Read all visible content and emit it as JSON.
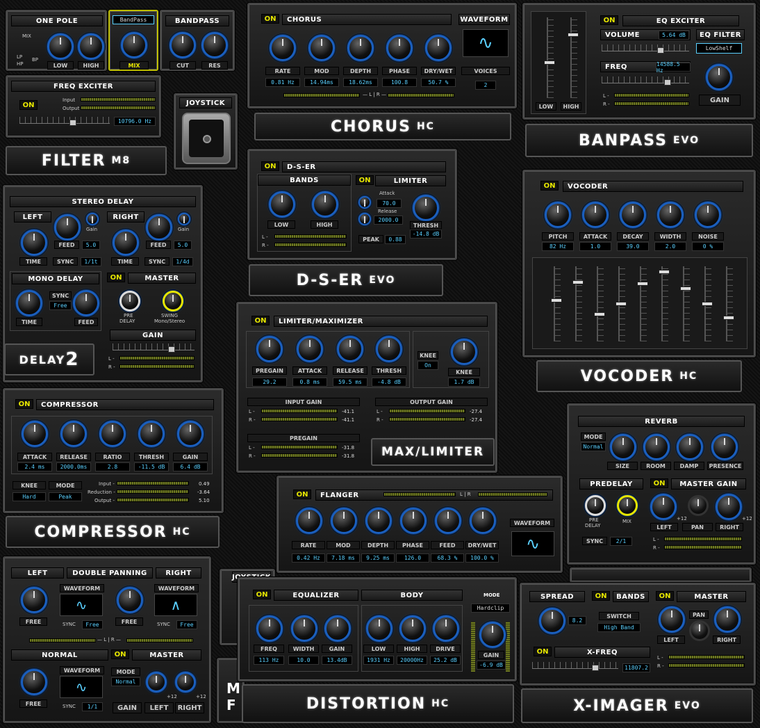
{
  "one_pole": {
    "title": "ONE POLE",
    "mix": "MIX",
    "lp": "LP",
    "hp": "HP",
    "bp": "BP",
    "low": "LOW",
    "high": "HIGH"
  },
  "mode_box": {
    "value": "BandPass",
    "mix": "MIX"
  },
  "bandpass": {
    "title": "BANDPASS",
    "cut": "CUT",
    "res": "RES"
  },
  "freq_exciter": {
    "title": "FREQ EXCITER",
    "on": "ON",
    "input": "Input",
    "output": "Output",
    "value": "10796.0 Hz"
  },
  "joystick": {
    "title": "JOYSTICK",
    "title2": "JOYSTICK"
  },
  "filter_logo": {
    "name": "FILTER",
    "suffix": "M8"
  },
  "chorus": {
    "on": "ON",
    "title": "CHORUS",
    "waveform": "WAVEFORM",
    "voices": "VOICES",
    "voices_value": "2",
    "knobs": [
      {
        "label": "RATE",
        "value": "0.81 Hz"
      },
      {
        "label": "MOD",
        "value": "14.94ms"
      },
      {
        "label": "DEPTH",
        "value": "18.62ms"
      },
      {
        "label": "PHASE",
        "value": "100.8"
      },
      {
        "label": "DRY/WET",
        "value": "50.7 %"
      }
    ],
    "lr": "— L | R —"
  },
  "chorus_logo": {
    "name": "CHORUS",
    "suffix": "HC"
  },
  "eq_exciter": {
    "on": "ON",
    "title": "EQ EXCITER",
    "volume": "VOLUME",
    "volume_value": "5.64 dB",
    "freq": "FREQ",
    "freq_value": "14588.5 Hz",
    "eq_filter": "EQ FILTER",
    "eq_filter_value": "LowShelf",
    "gain": "GAIN",
    "low": "LOW",
    "high": "HIGH",
    "l": "L -",
    "r": "R -"
  },
  "banpass_logo": {
    "name": "BANPASS",
    "suffix": "EVO"
  },
  "dser": {
    "on": "ON",
    "title": "D-S-ER",
    "bands": "BANDS",
    "low": "LOW",
    "high": "HIGH",
    "l": "L -",
    "r": "R -"
  },
  "limiter": {
    "on": "ON",
    "title": "LIMITER",
    "attack": "Attack",
    "attack_value": "70.0",
    "release": "Release",
    "release_value": "2000.0",
    "thresh": "THRESH",
    "thresh_value": "-14.8 dB",
    "peak": "PEAK",
    "peak_value": "0.88"
  },
  "dser_logo": {
    "name": "D-S-ER",
    "suffix": "EVO"
  },
  "vocoder": {
    "on": "ON",
    "title": "VOCODER",
    "knobs": [
      {
        "label": "PITCH",
        "value": "82  Hz"
      },
      {
        "label": "ATTACK",
        "value": "1.0"
      },
      {
        "label": "DECAY",
        "value": "39.0"
      },
      {
        "label": "WIDTH",
        "value": "2.0"
      },
      {
        "label": "NOISE",
        "value": "0 %"
      }
    ],
    "slider_levels": [
      0.55,
      0.8,
      0.35,
      0.5,
      0.78,
      0.95,
      0.72,
      0.5,
      0.3
    ]
  },
  "vocoder_logo": {
    "name": "VOCODER",
    "suffix": "HC"
  },
  "stereo_delay": {
    "title": "STEREO DELAY",
    "left": "LEFT",
    "right": "RIGHT",
    "gain": "Gain",
    "feed": "FEED",
    "feed_value": "5.0",
    "time": "TIME",
    "sync": "SYNC",
    "sync_l": "1/1t",
    "sync_r": "1/4d",
    "gain_r": "Gain",
    "feed_r": "FEED",
    "feed_value_r": "5.0",
    "time_r": "TIME",
    "sync_r_label": "SYNC"
  },
  "mono_delay": {
    "title": "MONO DELAY",
    "sync": "SYNC",
    "sync_value": "Free",
    "time": "TIME",
    "feed": "FEED"
  },
  "delay_master": {
    "on": "ON",
    "title": "MASTER",
    "pre": "PRE",
    "delay": "DELAY",
    "swing": "SWING",
    "swing_mode": "Mono/Stereo",
    "gain": "GAIN",
    "l": "L -",
    "r": "R -"
  },
  "delay_logo": {
    "name": "DELAY",
    "suffix": "2"
  },
  "lim_max": {
    "on": "ON",
    "title": "LIMITER/MAXIMIZER",
    "knobs": [
      {
        "label": "PREGAIN",
        "value": "29.2"
      },
      {
        "label": "ATTACK",
        "value": "0.8  ms"
      },
      {
        "label": "RELEASE",
        "value": "59.5  ms"
      },
      {
        "label": "THRESH",
        "value": "-4.8  dB"
      }
    ],
    "knee": "KNEE",
    "knee_state": "On",
    "knee_label": "KNEE",
    "knee_value": "1.7 dB",
    "input_gain": "INPUT GAIN",
    "in_l": "-41.1",
    "in_r": "-41.1",
    "output_gain": "OUTPUT GAIN",
    "out_l": "-27.4",
    "out_r": "-27.4",
    "pregain": "PREGAIN",
    "pre_l": "-31.8",
    "pre_r": "-31.8",
    "l": "L -",
    "r": "R -"
  },
  "maxlimiter_logo": {
    "name": "MAX/LIMITER"
  },
  "compressor": {
    "on": "ON",
    "title": "COMPRESSOR",
    "knobs": [
      {
        "label": "ATTACK",
        "value": "2.4  ms"
      },
      {
        "label": "RELEASE",
        "value": "2000.0ms"
      },
      {
        "label": "RATIO",
        "value": "2.8"
      },
      {
        "label": "THRESH",
        "value": "-11.5 dB"
      },
      {
        "label": "GAIN",
        "value": "6.4 dB"
      }
    ],
    "knee": "KNEE",
    "knee_value": "Hard",
    "mode": "MODE",
    "mode_value": "Peak",
    "input": "Input -",
    "reduction": "Reduction -",
    "output": "Output -",
    "input_value": "0.49",
    "reduction_value": "-3.64",
    "output_value": "5.10"
  },
  "compressor_logo": {
    "name": "COMPRESSOR",
    "suffix": "HC"
  },
  "reverb": {
    "title": "REVERB",
    "mode": "MODE",
    "mode_value": "Normal",
    "size": "SIZE",
    "room": "ROOM",
    "damp": "DAMP",
    "presence": "PRESENCE",
    "predelay": "PREDELAY",
    "pre": "PRE",
    "delay": "DELAY",
    "mix": "MIX",
    "sync": "SYNC",
    "sync_value": "2/1",
    "on": "ON",
    "master_gain": "MASTER GAIN",
    "left": "LEFT",
    "pan": "PAN",
    "right": "RIGHT",
    "plus12": "+12",
    "plus12b": "+12",
    "l": "L -",
    "r": "R -"
  },
  "flanger": {
    "on": "ON",
    "title": "FLANGER",
    "lr": "L | R",
    "waveform": "WAVEFORM",
    "knobs": [
      {
        "label": "RATE",
        "value": "0.42 Hz"
      },
      {
        "label": "MOD",
        "value": "7.18 ms"
      },
      {
        "label": "DEPTH",
        "value": "9.25 ms"
      },
      {
        "label": "PHASE",
        "value": "126.0"
      },
      {
        "label": "FEED",
        "value": "68.3 %"
      },
      {
        "label": "DRY/WET",
        "value": "100.0 %"
      }
    ]
  },
  "double_panning": {
    "left": "LEFT",
    "title": "DOUBLE PANNING",
    "right": "RIGHT",
    "waveform": "WAVEFORM",
    "waveform2": "WAVEFORM",
    "free": "FREE",
    "free2": "FREE",
    "sync": "SYNC",
    "sync_value": "Free",
    "sync2": "SYNC",
    "sync_value2": "Free",
    "lr": "— L | R —",
    "normal": "NORMAL",
    "on": "ON",
    "master": "MASTER",
    "waveform3": "WAVEFORM",
    "free3": "FREE",
    "sync3": "SYNC",
    "sync_value3": "1/1",
    "mode": "MODE",
    "mode_value": "Normal",
    "plus12": "+12",
    "plus12b": "+12",
    "gain": "GAIN",
    "m_left": "LEFT",
    "m_right": "RIGHT"
  },
  "distortion": {
    "on": "ON",
    "equalizer": "EQUALIZER",
    "body": "BODY",
    "mode": "MODE",
    "mode_value": "Hardclip",
    "eq_knobs": [
      {
        "label": "FREQ",
        "value": "113  Hz"
      },
      {
        "label": "WIDTH",
        "value": "10.0"
      },
      {
        "label": "GAIN",
        "value": "13.4dB"
      }
    ],
    "body_knobs": [
      {
        "label": "LOW",
        "value": "1931 Hz"
      },
      {
        "label": "HIGH",
        "value": "20000Hz"
      },
      {
        "label": "DRIVE",
        "value": "25.2 dB"
      }
    ],
    "gain": "GAIN",
    "gain_value": "-6.9 dB"
  },
  "distortion_logo": {
    "name": "DISTORTION",
    "suffix": "HC"
  },
  "ximager": {
    "spread": "SPREAD",
    "spread_value": "8.2",
    "on": "ON",
    "bands": "BANDS",
    "switch": "SWITCH",
    "switch_value": "High Band",
    "on2": "ON",
    "master": "MASTER",
    "pan": "PAN",
    "left": "LEFT",
    "right": "RIGHT",
    "on3": "ON",
    "xfreq": "X-FREQ",
    "xfreq_value": "11807.2",
    "l": "L -",
    "r": "R -"
  },
  "ximager_logo": {
    "name": "X-IMAGER",
    "suffix": "EVO"
  },
  "partial": {
    "m": "M",
    "f": "F"
  }
}
